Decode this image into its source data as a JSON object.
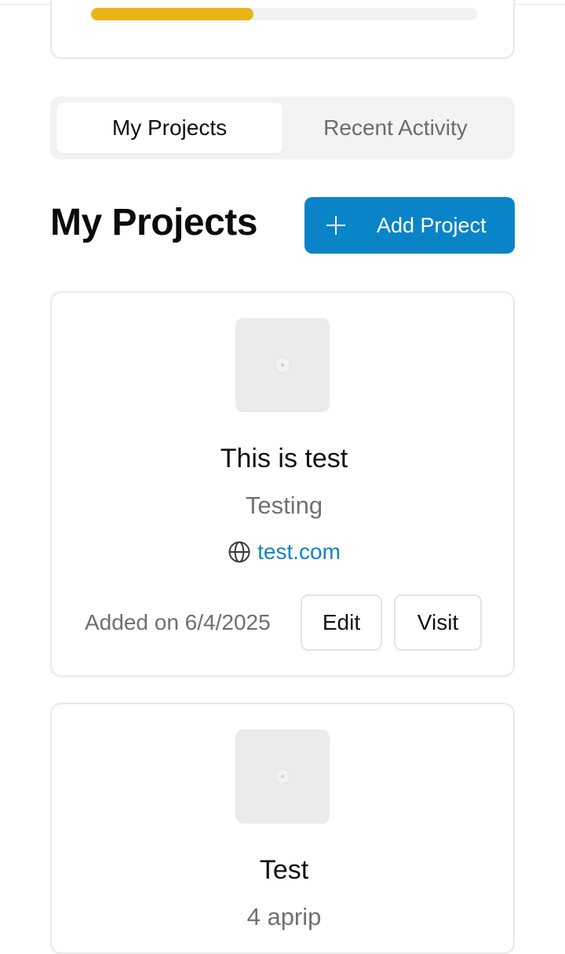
{
  "progress": {
    "fraction": 0.42,
    "color": "#e9b517"
  },
  "tabs": [
    {
      "label": "My Projects",
      "active": true
    },
    {
      "label": "Recent Activity",
      "active": false
    }
  ],
  "header": {
    "title": "My Projects",
    "add_button_label": "Add Project",
    "accent_color": "#0a84c8"
  },
  "projects": [
    {
      "title": "This is test",
      "description": "Testing",
      "link": "test.com",
      "added": "Added on 6/4/2025",
      "edit_label": "Edit",
      "visit_label": "Visit"
    },
    {
      "title": "Test",
      "description": "4 aprip"
    }
  ],
  "icons": {
    "plus": "plus-icon",
    "globe": "globe-icon",
    "placeholder": "image-placeholder-icon"
  }
}
